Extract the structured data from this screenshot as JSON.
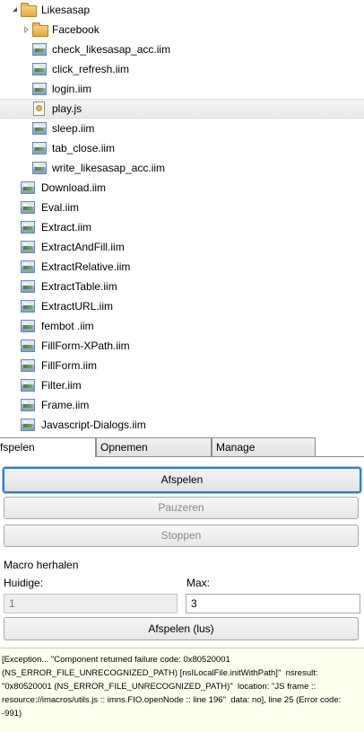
{
  "tree": {
    "items": [
      {
        "label": "Likesasap",
        "type": "folder",
        "expander": "open"
      },
      {
        "label": "Facebook",
        "type": "folder",
        "expander": "closed"
      },
      {
        "label": "check_likesasap_acc.iim",
        "type": "iim"
      },
      {
        "label": "click_refresh.iim",
        "type": "iim"
      },
      {
        "label": "login.iim",
        "type": "iim"
      },
      {
        "label": "play.js",
        "type": "js",
        "selected": true
      },
      {
        "label": "sleep.iim",
        "type": "iim"
      },
      {
        "label": "tab_close.iim",
        "type": "iim"
      },
      {
        "label": "write_likesasap_acc.iim",
        "type": "iim"
      },
      {
        "label": "Download.iim",
        "type": "iim"
      },
      {
        "label": "Eval.iim",
        "type": "iim"
      },
      {
        "label": "Extract.iim",
        "type": "iim"
      },
      {
        "label": "ExtractAndFill.iim",
        "type": "iim"
      },
      {
        "label": "ExtractRelative.iim",
        "type": "iim"
      },
      {
        "label": "ExtractTable.iim",
        "type": "iim"
      },
      {
        "label": "ExtractURL.iim",
        "type": "iim"
      },
      {
        "label": "fembot .iim",
        "type": "iim"
      },
      {
        "label": "FillForm-XPath.iim",
        "type": "iim"
      },
      {
        "label": "FillForm.iim",
        "type": "iim"
      },
      {
        "label": "Filter.iim",
        "type": "iim"
      },
      {
        "label": "Frame.iim",
        "type": "iim"
      },
      {
        "label": "Javascript-Dialogs.iim",
        "type": "iim"
      }
    ]
  },
  "tabs": [
    {
      "label": "fspelen",
      "active": true
    },
    {
      "label": "Opnemen",
      "active": false
    },
    {
      "label": "Manage",
      "active": false
    }
  ],
  "play": {
    "play_label": "Afspelen",
    "pause_label": "Pauzeren",
    "stop_label": "Stoppen"
  },
  "loop": {
    "heading": "Macro herhalen",
    "current_label": "Huidige:",
    "max_label": "Max:",
    "current_value": "1",
    "max_value": "3",
    "loop_button_label": "Afspelen (lus)"
  },
  "log": {
    "message": "[Exception... \"Component returned failure code: 0x80520001 (NS_ERROR_FILE_UNRECOGNIZED_PATH) [nsILocalFile.initWithPath]\"  nsresult: \"0x80520001 (NS_ERROR_FILE_UNRECOGNIZED_PATH)\"  location: \"JS frame :: resource://imacros/utils.js :: imns.FIO.openNode :: line 196\"  data: no], line 25 (Error code: -991)"
  },
  "colors": {
    "selected_row": "#e9e9e9",
    "focus_border": "#2d7fd6",
    "log_background": "#fffff0"
  }
}
